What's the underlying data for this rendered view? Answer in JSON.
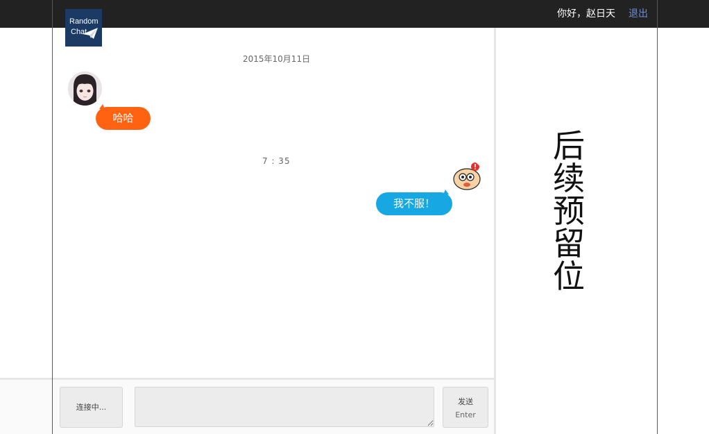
{
  "header": {
    "logo_line1": "Random",
    "logo_line2": "Chat",
    "greeting": "你好，赵日天",
    "logout_label": "退出"
  },
  "chat": {
    "date": "2015年10月11日",
    "messages": [
      {
        "side": "left",
        "text": "哈哈"
      },
      {
        "side": "right",
        "text": "我不服！"
      }
    ],
    "time": "7 : 35"
  },
  "composer": {
    "status_label": "连接中...",
    "send_label": "发送",
    "send_hint": "Enter",
    "input_value": ""
  },
  "sidebar": {
    "placeholder_text": "后续预留位"
  },
  "colors": {
    "topbar": "#222222",
    "accent_orange": "#ff6211",
    "accent_blue": "#17a8e3",
    "logout_link": "#6d8ed9",
    "guide_line": "#c0282f"
  },
  "icons": [
    "paper-plane-icon",
    "girl-avatar",
    "cartoon-avatar"
  ]
}
